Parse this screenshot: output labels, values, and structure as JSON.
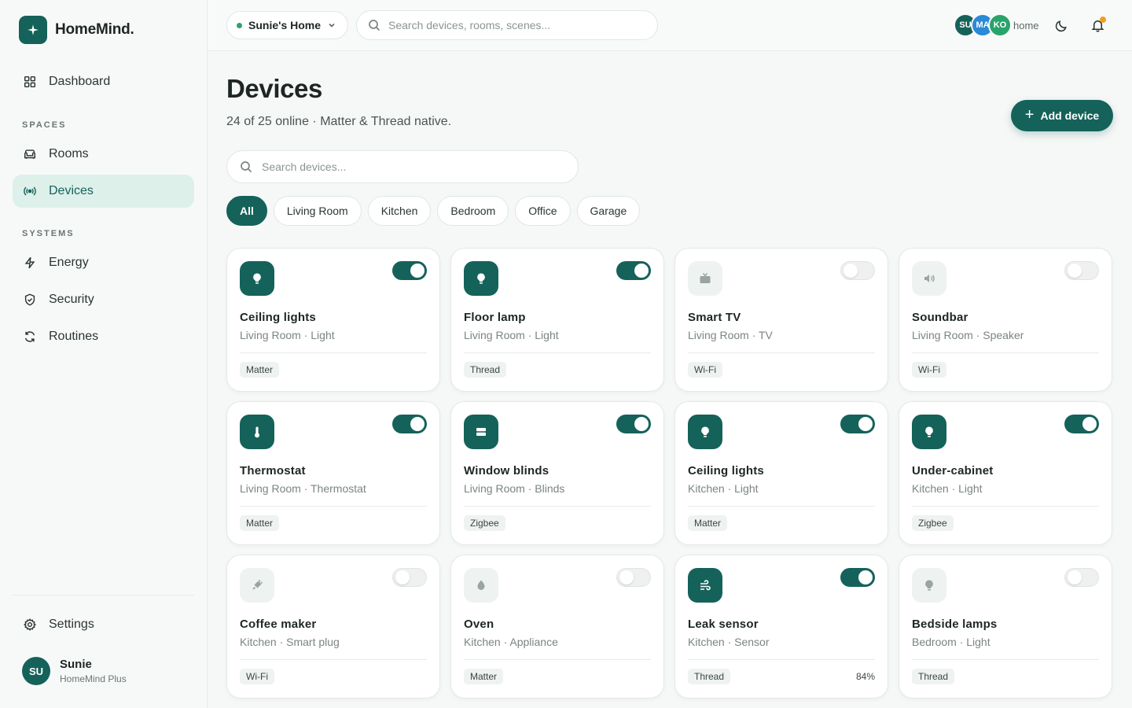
{
  "app": {
    "name": "HomeMind."
  },
  "colors": {
    "accent": "#15625a",
    "accent_light": "#ddf0ea",
    "online_dot": "#2aa36b",
    "notification": "#f0a020"
  },
  "sidebar": {
    "dashboard": "Dashboard",
    "spaces_label": "SPACES",
    "rooms": "Rooms",
    "devices": "Devices",
    "systems_label": "SYSTEMS",
    "energy": "Energy",
    "security": "Security",
    "routines": "Routines",
    "settings": "Settings",
    "user": {
      "initials": "SU",
      "name": "Sunie",
      "plan": "HomeMind Plus"
    }
  },
  "topbar": {
    "home": "Sunie's Home",
    "search_placeholder": "Search devices, rooms, scenes...",
    "members": [
      {
        "initials": "SU",
        "color": "#15625a"
      },
      {
        "initials": "MA",
        "color": "#2a8ad6"
      },
      {
        "initials": "KO",
        "color": "#2aa36b"
      }
    ],
    "members_label": "home"
  },
  "main": {
    "title": "Devices",
    "subtitle": "24 of 25 online · Matter & Thread native.",
    "add_button": "Add device",
    "search_placeholder": "Search devices...",
    "filters": [
      "All",
      "Living Room",
      "Kitchen",
      "Bedroom",
      "Office",
      "Garage"
    ],
    "active_filter": "All"
  },
  "devices": [
    {
      "name": "Ceiling lights",
      "meta": "Living Room · Light",
      "protocol": "Matter",
      "on": true,
      "icon": "bulb-icon",
      "extra": ""
    },
    {
      "name": "Floor lamp",
      "meta": "Living Room · Light",
      "protocol": "Thread",
      "on": true,
      "icon": "bulb-icon",
      "extra": ""
    },
    {
      "name": "Smart TV",
      "meta": "Living Room · TV",
      "protocol": "Wi-Fi",
      "on": false,
      "icon": "tv-icon",
      "extra": ""
    },
    {
      "name": "Soundbar",
      "meta": "Living Room · Speaker",
      "protocol": "Wi-Fi",
      "on": false,
      "icon": "speaker-icon",
      "extra": ""
    },
    {
      "name": "Thermostat",
      "meta": "Living Room · Thermostat",
      "protocol": "Matter",
      "on": true,
      "icon": "thermometer-icon",
      "extra": ""
    },
    {
      "name": "Window blinds",
      "meta": "Living Room · Blinds",
      "protocol": "Zigbee",
      "on": true,
      "icon": "blinds-icon",
      "extra": ""
    },
    {
      "name": "Ceiling lights",
      "meta": "Kitchen · Light",
      "protocol": "Matter",
      "on": true,
      "icon": "bulb-icon",
      "extra": ""
    },
    {
      "name": "Under-cabinet",
      "meta": "Kitchen · Light",
      "protocol": "Zigbee",
      "on": true,
      "icon": "bulb-icon",
      "extra": ""
    },
    {
      "name": "Coffee maker",
      "meta": "Kitchen · Smart plug",
      "protocol": "Wi-Fi",
      "on": false,
      "icon": "plug-icon",
      "extra": ""
    },
    {
      "name": "Oven",
      "meta": "Kitchen · Appliance",
      "protocol": "Matter",
      "on": false,
      "icon": "flame-icon",
      "extra": ""
    },
    {
      "name": "Leak sensor",
      "meta": "Kitchen · Sensor",
      "protocol": "Thread",
      "on": true,
      "icon": "wind-icon",
      "extra": "84%"
    },
    {
      "name": "Bedside lamps",
      "meta": "Bedroom · Light",
      "protocol": "Thread",
      "on": false,
      "icon": "bulb-icon",
      "extra": ""
    }
  ]
}
